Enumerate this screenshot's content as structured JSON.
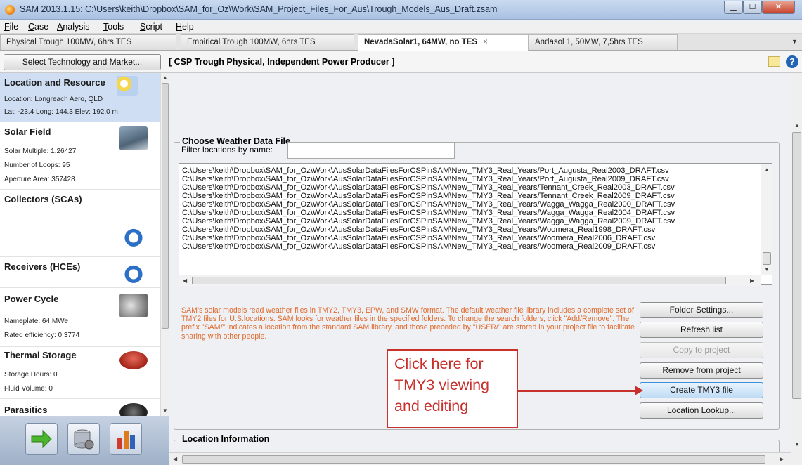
{
  "window": {
    "title": "SAM 2013.1.15: C:\\Users\\keith\\Dropbox\\SAM_for_Oz\\Work\\SAM_Project_Files_For_Aus\\Trough_Models_Aus_Draft.zsam"
  },
  "menu": [
    "File",
    "Case",
    "Analysis",
    "Tools",
    "Script",
    "Help"
  ],
  "tabs": [
    {
      "label": "Physical Trough 100MW, 6hrs TES"
    },
    {
      "label": "Empirical Trough 100MW, 6hrs TES"
    },
    {
      "label": "NevadaSolar1, 64MW, no TES",
      "close": "×"
    },
    {
      "label": "Andasol 1, 50MW, 7,5hrs TES"
    }
  ],
  "toolbar": {
    "select_button": "Select Technology and Market...",
    "config_label": "[ CSP Trough Physical, Independent Power Producer ]",
    "help": "?"
  },
  "sidebar": {
    "items": [
      {
        "title": "Location and Resource",
        "lines": [
          "Location: Longreach Aero, QLD",
          "Lat: -23.4 Long: 144.3 Elev: 192.0 m"
        ]
      },
      {
        "title": "Solar Field",
        "lines": [
          "Solar Multiple: 1.26427",
          "Number of Loops: 95",
          "Aperture Area: 357428"
        ]
      },
      {
        "title": "Collectors (SCAs)",
        "lines": []
      },
      {
        "title": "Receivers (HCEs)",
        "lines": []
      },
      {
        "title": "Power Cycle",
        "lines": [
          "Nameplate: 64 MWe",
          "Rated efficiency: 0.3774"
        ]
      },
      {
        "title": "Thermal Storage",
        "lines": [
          "Storage Hours: 0",
          "Fluid Volume: 0"
        ]
      },
      {
        "title": "Parasitics",
        "lines": []
      }
    ]
  },
  "weather": {
    "group_title": "Choose Weather Data File",
    "filter_label": "Filter locations by name:",
    "filter_value": "",
    "files": [
      "C:\\Users\\keith\\Dropbox\\SAM_for_Oz\\Work\\AusSolarDataFilesForCSPinSAM\\New_TMY3_Real_Years/Port_Augusta_Real2003_DRAFT.csv",
      "C:\\Users\\keith\\Dropbox\\SAM_for_Oz\\Work\\AusSolarDataFilesForCSPinSAM\\New_TMY3_Real_Years/Port_Augusta_Real2009_DRAFT.csv",
      "C:\\Users\\keith\\Dropbox\\SAM_for_Oz\\Work\\AusSolarDataFilesForCSPinSAM\\New_TMY3_Real_Years/Tennant_Creek_Real2003_DRAFT.csv",
      "C:\\Users\\keith\\Dropbox\\SAM_for_Oz\\Work\\AusSolarDataFilesForCSPinSAM\\New_TMY3_Real_Years/Tennant_Creek_Real2009_DRAFT.csv",
      "C:\\Users\\keith\\Dropbox\\SAM_for_Oz\\Work\\AusSolarDataFilesForCSPinSAM\\New_TMY3_Real_Years/Wagga_Wagga_Real2000_DRAFT.csv",
      "C:\\Users\\keith\\Dropbox\\SAM_for_Oz\\Work\\AusSolarDataFilesForCSPinSAM\\New_TMY3_Real_Years/Wagga_Wagga_Real2004_DRAFT.csv",
      "C:\\Users\\keith\\Dropbox\\SAM_for_Oz\\Work\\AusSolarDataFilesForCSPinSAM\\New_TMY3_Real_Years/Wagga_Wagga_Real2009_DRAFT.csv",
      "C:\\Users\\keith\\Dropbox\\SAM_for_Oz\\Work\\AusSolarDataFilesForCSPinSAM\\New_TMY3_Real_Years/Woomera_Real1998_DRAFT.csv",
      "C:\\Users\\keith\\Dropbox\\SAM_for_Oz\\Work\\AusSolarDataFilesForCSPinSAM\\New_TMY3_Real_Years/Woomera_Real2006_DRAFT.csv",
      "C:\\Users\\keith\\Dropbox\\SAM_for_Oz\\Work\\AusSolarDataFilesForCSPinSAM\\New_TMY3_Real_Years/Woomera_Real2009_DRAFT.csv"
    ],
    "help_text": "SAM's solar models read weather files in TMY2, TMY3, EPW, and SMW format. The default weather file library includes a complete set of TMY2 files for U.S.locations.  SAM looks for weather files in the specified folders. To change the search folders, click \"Add/Remove\".  The prefix \"SAM/\" indicates a location from the standard SAM library, and those preceded by \"USER/\" are stored in your project file to facilitate sharing with other people.",
    "buttons": {
      "folder_settings": "Folder Settings...",
      "refresh_list": "Refresh list",
      "copy_to_project": "Copy to project",
      "remove_from_project": "Remove from project",
      "create_tmy3": "Create TMY3 file",
      "location_lookup": "Location Lookup..."
    }
  },
  "location_info": {
    "group_title": "Location Information"
  },
  "callout": {
    "text": "Click here for TMY3 viewing and editing"
  },
  "colors": {
    "callout": "#c8302c",
    "help_text": "#e06a2e",
    "active_sidebar": "#cfdef3"
  }
}
